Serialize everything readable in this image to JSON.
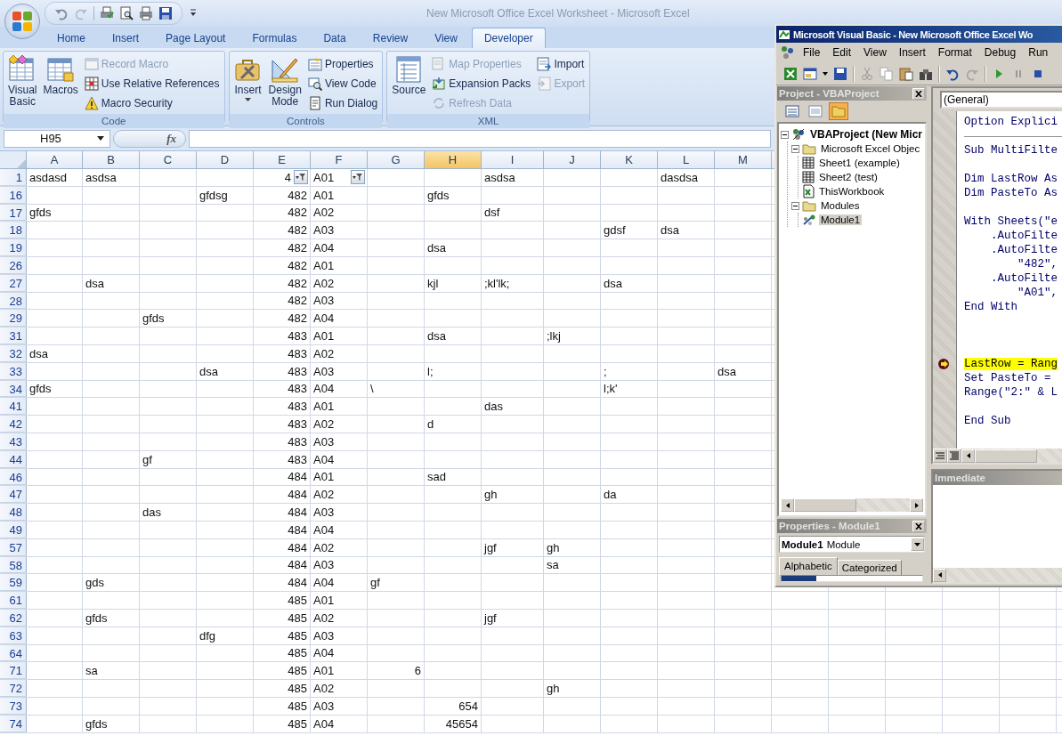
{
  "window": {
    "title": "New Microsoft Office Excel Worksheet - Microsoft Excel"
  },
  "tabs": [
    {
      "label": "Home",
      "selected": false
    },
    {
      "label": "Insert",
      "selected": false
    },
    {
      "label": "Page Layout",
      "selected": false
    },
    {
      "label": "Formulas",
      "selected": false
    },
    {
      "label": "Data",
      "selected": false
    },
    {
      "label": "Review",
      "selected": false
    },
    {
      "label": "View",
      "selected": false
    },
    {
      "label": "Developer",
      "selected": true
    }
  ],
  "ribbon": {
    "groups": [
      {
        "label": "Code",
        "large": [
          {
            "label": "Visual Basic",
            "has_menu": false
          },
          {
            "label": "Macros",
            "has_menu": false
          }
        ],
        "small": [
          {
            "label": "Record Macro",
            "disabled": true
          },
          {
            "label": "Use Relative References",
            "disabled": false
          },
          {
            "label": "Macro Security",
            "disabled": false
          }
        ]
      },
      {
        "label": "Controls",
        "large": [
          {
            "label": "Insert",
            "has_menu": true
          },
          {
            "label": "Design Mode",
            "has_menu": false
          }
        ],
        "small": [
          {
            "label": "Properties",
            "disabled": false
          },
          {
            "label": "View Code",
            "disabled": false
          },
          {
            "label": "Run Dialog",
            "disabled": false
          }
        ]
      },
      {
        "label": "XML",
        "large": [
          {
            "label": "Source",
            "has_menu": false
          }
        ],
        "small": [
          {
            "label": "Map Properties",
            "disabled": true
          },
          {
            "label": "Expansion Packs",
            "disabled": false
          },
          {
            "label": "Refresh Data",
            "disabled": true
          },
          {
            "label": "Import",
            "disabled": false
          },
          {
            "label": "Export",
            "disabled": true
          }
        ]
      }
    ]
  },
  "formula_bar": {
    "name_box": "H95",
    "function_label": "fx"
  },
  "columns": [
    {
      "label": "A",
      "selected": false
    },
    {
      "label": "B",
      "selected": false
    },
    {
      "label": "C",
      "selected": false
    },
    {
      "label": "D",
      "selected": false
    },
    {
      "label": "E",
      "selected": false
    },
    {
      "label": "F",
      "selected": false
    },
    {
      "label": "G",
      "selected": false
    },
    {
      "label": "H",
      "selected": true
    },
    {
      "label": "I",
      "selected": false
    },
    {
      "label": "J",
      "selected": false
    },
    {
      "label": "K",
      "selected": false
    },
    {
      "label": "L",
      "selected": false
    },
    {
      "label": "M",
      "selected": false
    }
  ],
  "rows": [
    {
      "row": "1",
      "cells": {
        "A": {
          "kind": "text",
          "value": "asdasd"
        },
        "B": {
          "kind": "text",
          "value": "asdsa"
        },
        "E": {
          "kind": "number",
          "value": "4",
          "filter": true
        },
        "F": {
          "kind": "text",
          "value": "A01",
          "filter": true
        },
        "I": {
          "kind": "text",
          "value": "asdsa"
        },
        "L": {
          "kind": "text",
          "value": "dasdsa"
        }
      }
    },
    {
      "row": "16",
      "cells": {
        "D": {
          "kind": "text",
          "value": "gfdsg"
        },
        "E": {
          "kind": "number",
          "value": "482"
        },
        "F": {
          "kind": "text",
          "value": "A01"
        },
        "H": {
          "kind": "text",
          "value": "gfds"
        }
      }
    },
    {
      "row": "17",
      "cells": {
        "A": {
          "kind": "text",
          "value": "gfds"
        },
        "E": {
          "kind": "number",
          "value": "482"
        },
        "F": {
          "kind": "text",
          "value": "A02"
        },
        "I": {
          "kind": "text",
          "value": "dsf"
        }
      }
    },
    {
      "row": "18",
      "cells": {
        "E": {
          "kind": "number",
          "value": "482"
        },
        "F": {
          "kind": "text",
          "value": "A03"
        },
        "K": {
          "kind": "text",
          "value": "gdsf"
        },
        "L": {
          "kind": "text",
          "value": "dsa"
        }
      }
    },
    {
      "row": "19",
      "cells": {
        "E": {
          "kind": "number",
          "value": "482"
        },
        "F": {
          "kind": "text",
          "value": "A04"
        },
        "H": {
          "kind": "text",
          "value": "dsa"
        }
      }
    },
    {
      "row": "26",
      "cells": {
        "E": {
          "kind": "number",
          "value": "482"
        },
        "F": {
          "kind": "text",
          "value": "A01"
        }
      }
    },
    {
      "row": "27",
      "cells": {
        "B": {
          "kind": "text",
          "value": "dsa"
        },
        "E": {
          "kind": "number",
          "value": "482"
        },
        "F": {
          "kind": "text",
          "value": "A02"
        },
        "H": {
          "kind": "text",
          "value": "kjl"
        },
        "I": {
          "kind": "text",
          "value": ";kl'lk;"
        },
        "K": {
          "kind": "text",
          "value": "dsa"
        }
      }
    },
    {
      "row": "28",
      "cells": {
        "E": {
          "kind": "number",
          "value": "482"
        },
        "F": {
          "kind": "text",
          "value": "A03"
        }
      }
    },
    {
      "row": "29",
      "cells": {
        "C": {
          "kind": "text",
          "value": "gfds"
        },
        "E": {
          "kind": "number",
          "value": "482"
        },
        "F": {
          "kind": "text",
          "value": "A04"
        }
      }
    },
    {
      "row": "31",
      "cells": {
        "E": {
          "kind": "number",
          "value": "483"
        },
        "F": {
          "kind": "text",
          "value": "A01"
        },
        "H": {
          "kind": "text",
          "value": "dsa"
        },
        "J": {
          "kind": "text",
          "value": ";lkj"
        }
      }
    },
    {
      "row": "32",
      "cells": {
        "A": {
          "kind": "text",
          "value": "dsa"
        },
        "E": {
          "kind": "number",
          "value": "483"
        },
        "F": {
          "kind": "text",
          "value": "A02"
        }
      }
    },
    {
      "row": "33",
      "cells": {
        "D": {
          "kind": "text",
          "value": "dsa"
        },
        "E": {
          "kind": "number",
          "value": "483"
        },
        "F": {
          "kind": "text",
          "value": "A03"
        },
        "H": {
          "kind": "text",
          "value": "l;"
        },
        "K": {
          "kind": "text",
          "value": ";"
        },
        "M": {
          "kind": "text",
          "value": "dsa"
        }
      }
    },
    {
      "row": "34",
      "cells": {
        "A": {
          "kind": "text",
          "value": "gfds"
        },
        "E": {
          "kind": "number",
          "value": "483"
        },
        "F": {
          "kind": "text",
          "value": "A04"
        },
        "G": {
          "kind": "text",
          "value": "\\"
        },
        "K": {
          "kind": "text",
          "value": "l;k'"
        }
      }
    },
    {
      "row": "41",
      "cells": {
        "E": {
          "kind": "number",
          "value": "483"
        },
        "F": {
          "kind": "text",
          "value": "A01"
        },
        "I": {
          "kind": "text",
          "value": "das"
        }
      }
    },
    {
      "row": "42",
      "cells": {
        "E": {
          "kind": "number",
          "value": "483"
        },
        "F": {
          "kind": "text",
          "value": "A02"
        },
        "H": {
          "kind": "text",
          "value": "d"
        }
      }
    },
    {
      "row": "43",
      "cells": {
        "E": {
          "kind": "number",
          "value": "483"
        },
        "F": {
          "kind": "text",
          "value": "A03"
        }
      }
    },
    {
      "row": "44",
      "cells": {
        "C": {
          "kind": "text",
          "value": "gf"
        },
        "E": {
          "kind": "number",
          "value": "483"
        },
        "F": {
          "kind": "text",
          "value": "A04"
        }
      }
    },
    {
      "row": "46",
      "cells": {
        "E": {
          "kind": "number",
          "value": "484"
        },
        "F": {
          "kind": "text",
          "value": "A01"
        },
        "H": {
          "kind": "text",
          "value": "sad"
        }
      }
    },
    {
      "row": "47",
      "cells": {
        "E": {
          "kind": "number",
          "value": "484"
        },
        "F": {
          "kind": "text",
          "value": "A02"
        },
        "I": {
          "kind": "text",
          "value": "gh"
        },
        "K": {
          "kind": "text",
          "value": "da"
        }
      }
    },
    {
      "row": "48",
      "cells": {
        "C": {
          "kind": "text",
          "value": "das"
        },
        "E": {
          "kind": "number",
          "value": "484"
        },
        "F": {
          "kind": "text",
          "value": "A03"
        }
      }
    },
    {
      "row": "49",
      "cells": {
        "E": {
          "kind": "number",
          "value": "484"
        },
        "F": {
          "kind": "text",
          "value": "A04"
        }
      }
    },
    {
      "row": "57",
      "cells": {
        "E": {
          "kind": "number",
          "value": "484"
        },
        "F": {
          "kind": "text",
          "value": "A02"
        },
        "I": {
          "kind": "text",
          "value": "jgf"
        },
        "J": {
          "kind": "text",
          "value": "gh"
        }
      }
    },
    {
      "row": "58",
      "cells": {
        "E": {
          "kind": "number",
          "value": "484"
        },
        "F": {
          "kind": "text",
          "value": "A03"
        },
        "J": {
          "kind": "text",
          "value": "sa"
        }
      }
    },
    {
      "row": "59",
      "cells": {
        "B": {
          "kind": "text",
          "value": "gds"
        },
        "E": {
          "kind": "number",
          "value": "484"
        },
        "F": {
          "kind": "text",
          "value": "A04"
        },
        "G": {
          "kind": "text",
          "value": "gf"
        }
      }
    },
    {
      "row": "61",
      "cells": {
        "E": {
          "kind": "number",
          "value": "485"
        },
        "F": {
          "kind": "text",
          "value": "A01"
        }
      }
    },
    {
      "row": "62",
      "cells": {
        "B": {
          "kind": "text",
          "value": "gfds"
        },
        "E": {
          "kind": "number",
          "value": "485"
        },
        "F": {
          "kind": "text",
          "value": "A02"
        },
        "I": {
          "kind": "text",
          "value": "jgf"
        }
      }
    },
    {
      "row": "63",
      "cells": {
        "D": {
          "kind": "text",
          "value": "dfg"
        },
        "E": {
          "kind": "number",
          "value": "485"
        },
        "F": {
          "kind": "text",
          "value": "A03"
        }
      }
    },
    {
      "row": "64",
      "cells": {
        "E": {
          "kind": "number",
          "value": "485"
        },
        "F": {
          "kind": "text",
          "value": "A04"
        }
      }
    },
    {
      "row": "71",
      "cells": {
        "B": {
          "kind": "text",
          "value": "sa"
        },
        "E": {
          "kind": "number",
          "value": "485"
        },
        "F": {
          "kind": "text",
          "value": "A01"
        },
        "G": {
          "kind": "number",
          "value": "6"
        }
      }
    },
    {
      "row": "72",
      "cells": {
        "E": {
          "kind": "number",
          "value": "485"
        },
        "F": {
          "kind": "text",
          "value": "A02"
        },
        "J": {
          "kind": "text",
          "value": "gh"
        }
      }
    },
    {
      "row": "73",
      "cells": {
        "E": {
          "kind": "number",
          "value": "485"
        },
        "F": {
          "kind": "text",
          "value": "A03"
        },
        "H": {
          "kind": "number",
          "value": "654"
        }
      }
    },
    {
      "row": "74",
      "cells": {
        "B": {
          "kind": "text",
          "value": "gfds"
        },
        "E": {
          "kind": "number",
          "value": "485"
        },
        "F": {
          "kind": "text",
          "value": "A04"
        },
        "H": {
          "kind": "number",
          "value": "45654"
        }
      }
    }
  ],
  "vba": {
    "title": "Microsoft Visual Basic - New Microsoft Office Excel Wo",
    "menu": [
      "File",
      "Edit",
      "View",
      "Insert",
      "Format",
      "Debug",
      "Run"
    ],
    "project": {
      "title": "Project - VBAProject",
      "toolbar": [
        {
          "pressed": false
        },
        {
          "pressed": false
        },
        {
          "pressed": true
        }
      ],
      "tree": [
        {
          "label": "VBAProject (New Micr",
          "kind": "project",
          "expanded": true,
          "selected": false,
          "children": [
            {
              "label": "Microsoft Excel Objec",
              "kind": "folder",
              "expanded": true,
              "selected": false,
              "children": [
                {
                  "label": "Sheet1 (example)",
                  "kind": "sheet",
                  "selected": false
                },
                {
                  "label": "Sheet2 (test)",
                  "kind": "sheet",
                  "selected": false
                },
                {
                  "label": "ThisWorkbook",
                  "kind": "workbook",
                  "selected": false
                }
              ]
            },
            {
              "label": "Modules",
              "kind": "folder",
              "expanded": true,
              "selected": false,
              "children": [
                {
                  "label": "Module1",
                  "kind": "module",
                  "selected": true
                }
              ]
            }
          ]
        }
      ]
    },
    "properties": {
      "title": "Properties - Module1",
      "object": "Module1",
      "object_type": "Module",
      "tabs": [
        {
          "label": "Alphabetic",
          "selected": true
        },
        {
          "label": "Categorized",
          "selected": false
        }
      ]
    },
    "code": {
      "object": "(General)",
      "lines": [
        {
          "kind": "code",
          "text": "Option Explici",
          "current": false
        },
        {
          "kind": "separator"
        },
        {
          "kind": "code",
          "text": "Sub MultiFilte",
          "current": false
        },
        {
          "kind": "blank"
        },
        {
          "kind": "code",
          "text": "Dim LastRow As",
          "current": false
        },
        {
          "kind": "code",
          "text": "Dim PasteTo As",
          "current": false
        },
        {
          "kind": "blank"
        },
        {
          "kind": "code",
          "text": "With Sheets(\"e",
          "current": false
        },
        {
          "kind": "code",
          "text": "    .AutoFilte",
          "current": false
        },
        {
          "kind": "code",
          "text": "    .AutoFilte",
          "current": false
        },
        {
          "kind": "code",
          "text": "        \"482\",",
          "current": false
        },
        {
          "kind": "code",
          "text": "    .AutoFilte",
          "current": false
        },
        {
          "kind": "code",
          "text": "        \"A01\",",
          "current": false
        },
        {
          "kind": "code",
          "text": "End With",
          "current": false
        },
        {
          "kind": "blank"
        },
        {
          "kind": "blank"
        },
        {
          "kind": "blank"
        },
        {
          "kind": "code",
          "text": "LastRow = Rang",
          "current": true
        },
        {
          "kind": "code",
          "text": "Set PasteTo =",
          "current": false
        },
        {
          "kind": "code",
          "text": "Range(\"2:\" & L",
          "current": false
        },
        {
          "kind": "blank"
        },
        {
          "kind": "code",
          "text": "End Sub",
          "current": false
        }
      ]
    },
    "immediate": {
      "title": "Immediate"
    }
  }
}
